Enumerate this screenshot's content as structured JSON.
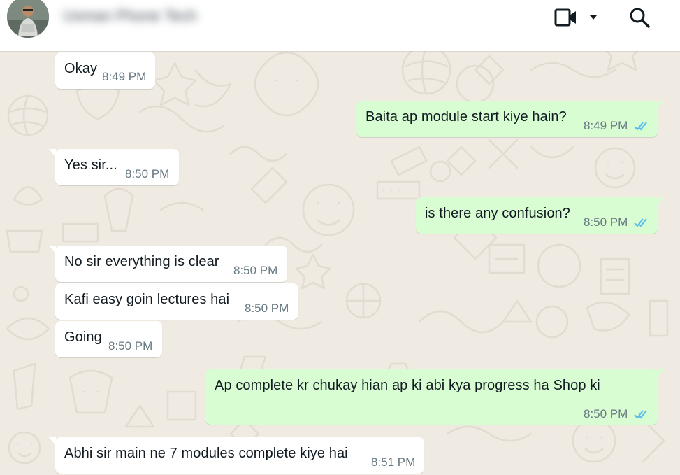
{
  "header": {
    "contact_name": "Usman Phone Tech",
    "video_call_icon": "video-camera-icon",
    "dropdown_icon": "caret-down-icon",
    "search_icon": "search-icon"
  },
  "colors": {
    "header_bg": "#ffffff",
    "chat_bg": "#efeae2",
    "incoming_bubble": "#ffffff",
    "outgoing_bubble": "#d9fdd3",
    "read_ticks": "#53bdeb",
    "timestamp": "#667781"
  },
  "messages": [
    {
      "direction": "incoming",
      "text": "Okay",
      "time": "8:49 PM"
    },
    {
      "direction": "outgoing",
      "text": "Baita ap module start kiye hain?",
      "time": "8:49 PM",
      "status": "read"
    },
    {
      "direction": "incoming",
      "text": "Yes sir...",
      "time": "8:50 PM"
    },
    {
      "direction": "outgoing",
      "text": "is there any confusion?",
      "time": "8:50 PM",
      "status": "read"
    },
    {
      "direction": "incoming",
      "text": "No sir everything is clear",
      "time": "8:50 PM"
    },
    {
      "direction": "incoming",
      "text": "Kafi easy goin lectures hai",
      "time": "8:50 PM"
    },
    {
      "direction": "incoming",
      "text": "Going",
      "time": "8:50 PM"
    },
    {
      "direction": "outgoing",
      "text": "Ap complete kr chukay hian ap ki abi kya progress ha Shop ki",
      "time": "8:50 PM",
      "status": "read"
    },
    {
      "direction": "incoming",
      "text": "Abhi sir main ne 7 modules complete kiye hai",
      "time": "8:51 PM"
    }
  ]
}
